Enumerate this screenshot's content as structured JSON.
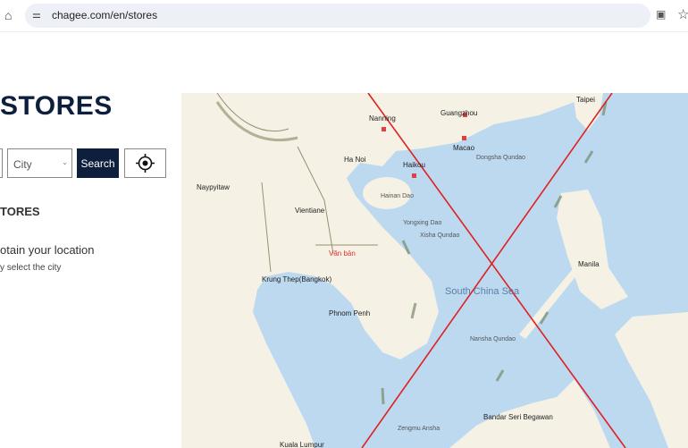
{
  "browser": {
    "url": "chagee.com/en/stores"
  },
  "page": {
    "title": "STORES",
    "city_placeholder": "City",
    "search_label": "Search",
    "stores_heading": "TORES",
    "location_msg": "otain your location",
    "location_hint": "y select the city"
  },
  "map": {
    "labels": {
      "nanning": "Nanning",
      "guangzhou": "Guangzhou",
      "taipei": "Taipei",
      "macao": "Macao",
      "dongsha": "Dongsha Qundao",
      "hanoi": "Ha Noi",
      "haikou": "Haikou",
      "naypyitaw": "Naypyitaw",
      "hainan": "Hainan Dao",
      "vientiane": "Vientiane",
      "yongxing": "Yongxing Dao",
      "xisha": "Xisha Qundao",
      "vanban": "Văn bản",
      "manila": "Manila",
      "bangkok": "Krung Thep(Bangkok)",
      "scs": "South China Sea",
      "phnompenh": "Phnom Penh",
      "nansha": "Nansha Qundao",
      "bandar": "Bandar Seri Begawan",
      "zengmu": "Zengmu Ansha",
      "kl": "Kuala Lumpur"
    }
  },
  "colors": {
    "brand": "#0d1f3c",
    "sea": "#bcd9f0",
    "land": "#f5f1e4",
    "cross": "#e02020"
  }
}
